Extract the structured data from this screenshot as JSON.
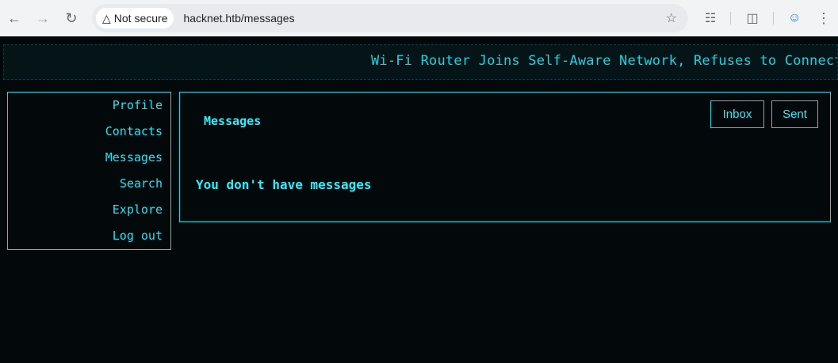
{
  "browser": {
    "security_label": "Not secure",
    "url": "hacknet.htb/messages"
  },
  "ticker": {
    "text": "Wi-Fi Router Joins Self-Aware Network, Refuses to Connect"
  },
  "sidebar": {
    "items": [
      {
        "label": "Profile"
      },
      {
        "label": "Contacts"
      },
      {
        "label": "Messages"
      },
      {
        "label": "Search"
      },
      {
        "label": "Explore"
      },
      {
        "label": "Log out"
      }
    ]
  },
  "messages": {
    "title": "Messages",
    "inbox_label": "Inbox",
    "sent_label": "Sent",
    "empty_text": "You don't have messages"
  },
  "colors": {
    "accent": "#14d8ea",
    "background": "#03090b"
  }
}
